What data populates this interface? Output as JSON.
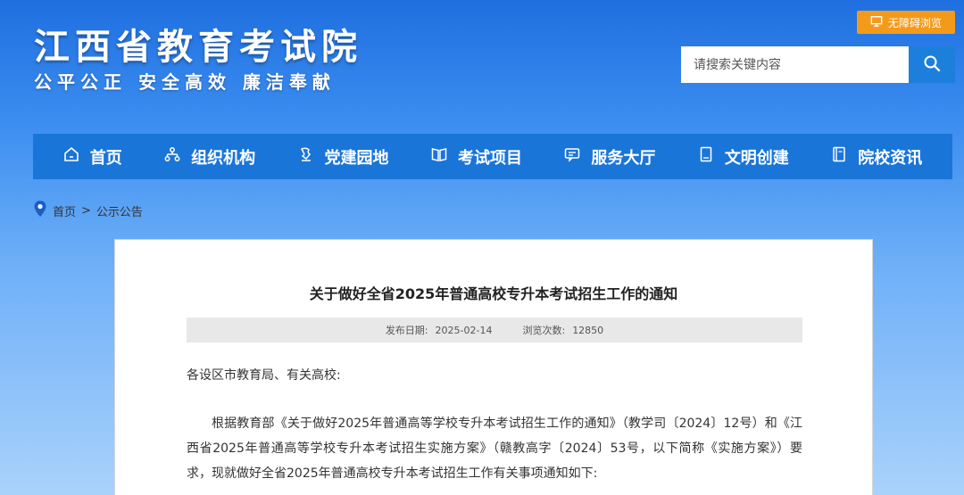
{
  "header": {
    "site_title": "江西省教育考试院",
    "slogan": "公平公正  安全高效  廉洁奉献",
    "accessibility_label": "无障碍浏览",
    "search_placeholder": "请搜索关键内容"
  },
  "nav": {
    "items": [
      {
        "label": "首页",
        "icon": "home-icon"
      },
      {
        "label": "组织机构",
        "icon": "org-chart-icon"
      },
      {
        "label": "党建园地",
        "icon": "party-icon"
      },
      {
        "label": "考试项目",
        "icon": "book-icon"
      },
      {
        "label": "服务大厅",
        "icon": "service-icon"
      },
      {
        "label": "文明创建",
        "icon": "document-icon"
      },
      {
        "label": "院校资讯",
        "icon": "news-icon"
      }
    ]
  },
  "breadcrumb": {
    "home": "首页",
    "separator": ">",
    "current": "公示公告"
  },
  "article": {
    "title": "关于做好全省2025年普通高校专升本考试招生工作的通知",
    "publish_label": "发布日期:",
    "publish_date": "2025-02-14",
    "views_label": "浏览次数:",
    "views": "12850",
    "salutation": "各设区市教育局、有关高校:",
    "paragraph": "根据教育部《关于做好2025年普通高等学校专升本考试招生工作的通知》（教学司〔2024〕12号）和《江西省2025年普通高等学校专升本考试招生实施方案》（赣教高字〔2024〕53号，以下简称《实施方案》）要求，现就做好全省2025年普通高校专升本考试招生工作有关事项通知如下:"
  },
  "colors": {
    "nav_bg": "#1a75d8",
    "accent_orange": "#f49a1b",
    "search_btn": "#1d7fdc"
  }
}
